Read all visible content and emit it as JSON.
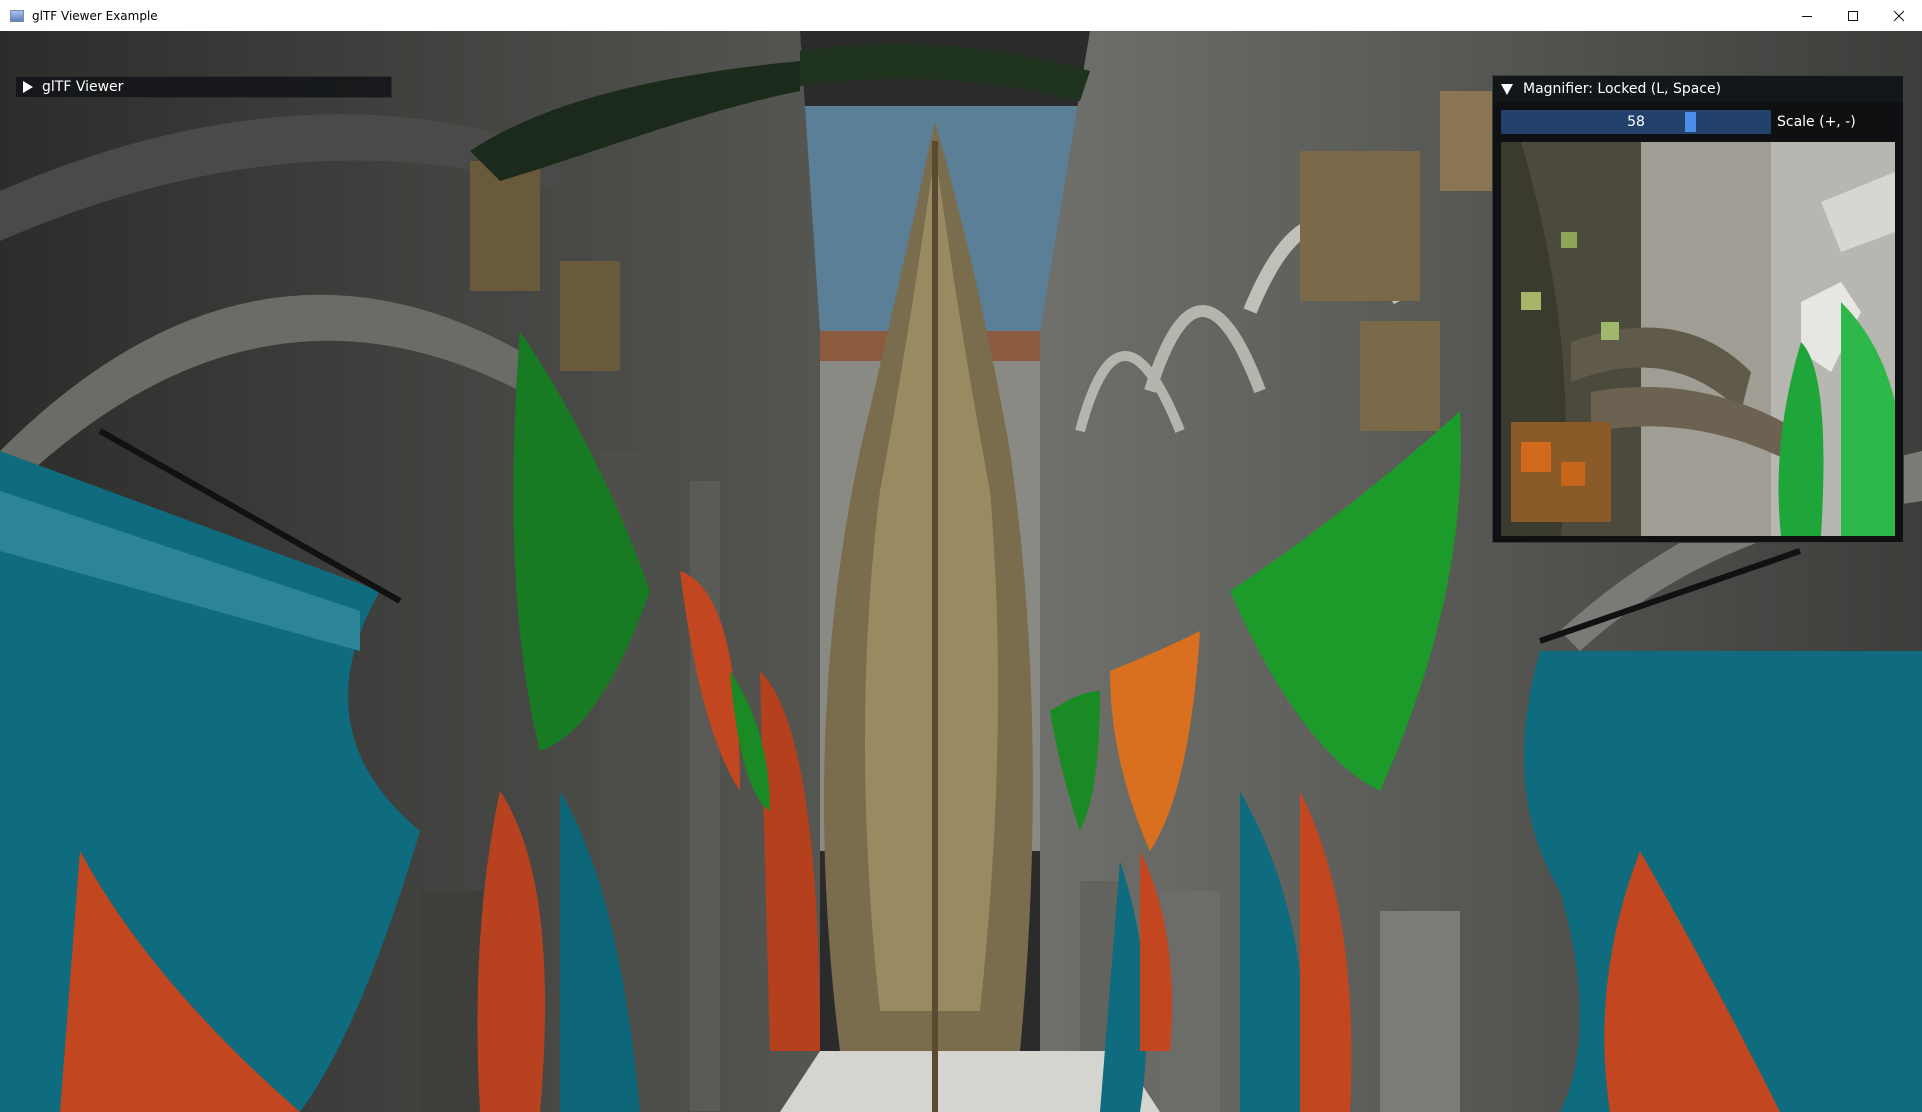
{
  "window": {
    "title": "glTF Viewer Example",
    "buttons": {
      "minimize": "minimize-icon",
      "maximize": "maximize-icon",
      "close": "close-icon"
    }
  },
  "imgui": {
    "collapsed_window_title": "glTF Viewer"
  },
  "magnifier": {
    "title": "Magnifier: Locked (L, Space)",
    "slider_value": "58",
    "slider_fraction": 0.58,
    "scale_label": "Scale (+, -)"
  },
  "colors": {
    "imgui_slider_bg": "#22426b",
    "imgui_slider_grab": "#4c8fe8",
    "sky": "#5a7f96",
    "curtain_teal": "#0f6b7e",
    "curtain_orange": "#c2461f",
    "cloth_green": "#1c9a2a"
  }
}
